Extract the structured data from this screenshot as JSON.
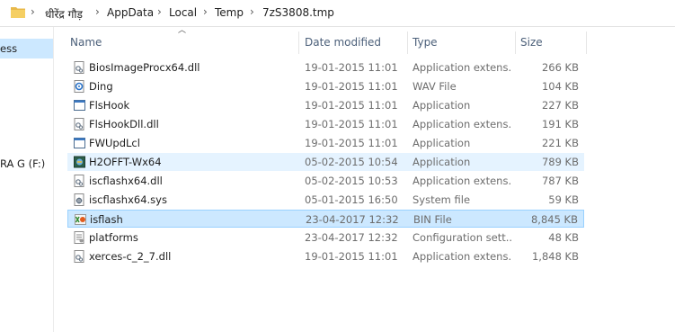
{
  "breadcrumb": [
    "धीरेंद्र गौड़",
    "AppData",
    "Local",
    "Temp",
    "7zS3808.tmp"
  ],
  "nav": {
    "selected_item": "ess",
    "drive_item": "RA G (F:)"
  },
  "columns": {
    "name": "Name",
    "date": "Date modified",
    "type": "Type",
    "size": "Size"
  },
  "files": [
    {
      "name": "BiosImageProcx64.dll",
      "date": "19-01-2015 11:01",
      "type": "Application extens...",
      "size": "266 KB",
      "icon": "dll-icon"
    },
    {
      "name": "Ding",
      "date": "19-01-2015 11:01",
      "type": "WAV File",
      "size": "104 KB",
      "icon": "audio-file-icon"
    },
    {
      "name": "FlsHook",
      "date": "19-01-2015 11:01",
      "type": "Application",
      "size": "227 KB",
      "icon": "app-icon"
    },
    {
      "name": "FlsHookDll.dll",
      "date": "19-01-2015 11:01",
      "type": "Application extens...",
      "size": "191 KB",
      "icon": "dll-icon"
    },
    {
      "name": "FWUpdLcl",
      "date": "19-01-2015 11:01",
      "type": "Application",
      "size": "221 KB",
      "icon": "app-icon"
    },
    {
      "name": "H2OFFT-Wx64",
      "date": "05-02-2015 10:54",
      "type": "Application",
      "size": "789 KB",
      "icon": "flash-app-icon"
    },
    {
      "name": "iscflashx64.dll",
      "date": "05-02-2015 10:53",
      "type": "Application extens...",
      "size": "787 KB",
      "icon": "dll-icon"
    },
    {
      "name": "iscflashx64.sys",
      "date": "05-01-2015 16:50",
      "type": "System file",
      "size": "59 KB",
      "icon": "sys-file-icon"
    },
    {
      "name": "isflash",
      "date": "23-04-2017 12:32",
      "type": "BIN File",
      "size": "8,845 KB",
      "icon": "bin-file-icon"
    },
    {
      "name": "platforms",
      "date": "23-04-2017 12:32",
      "type": "Configuration sett...",
      "size": "48 KB",
      "icon": "config-file-icon"
    },
    {
      "name": "xerces-c_2_7.dll",
      "date": "19-01-2015 11:01",
      "type": "Application extens...",
      "size": "1,848 KB",
      "icon": "dll-icon"
    }
  ],
  "selected_file": "isflash",
  "hovered_file": "H2OFFT-Wx64",
  "colors": {
    "selection": "#cce8ff",
    "hover": "#e5f3ff",
    "header_text": "#4c607a",
    "secondary_text": "#6d6d6d"
  }
}
